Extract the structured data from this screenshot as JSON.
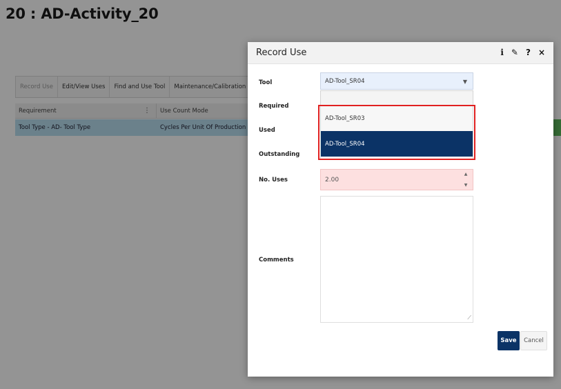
{
  "page": {
    "title": "20 : AD-Activity_20"
  },
  "toolbar": {
    "items": [
      {
        "label": "Record Use"
      },
      {
        "label": "Edit/View Uses"
      },
      {
        "label": "Find and Use Tool"
      },
      {
        "label": "Maintenance/Calibration"
      }
    ]
  },
  "grid": {
    "columns": [
      "Requirement",
      "Use Count Mode"
    ],
    "rows": [
      {
        "requirement": "Tool Type - AD- Tool Type",
        "use_count_mode": "Cycles Per Unit Of Production"
      }
    ]
  },
  "modal": {
    "title": "Record Use",
    "header_icons": [
      "info-icon",
      "pencil-icon",
      "help-icon",
      "close-icon"
    ],
    "header_glyphs": {
      "info": "i",
      "edit": "✎",
      "help": "?",
      "close": "×"
    },
    "labels": {
      "tool": "Tool",
      "required": "Required",
      "used": "Used",
      "outstanding": "Outstanding",
      "no_uses": "No. Uses",
      "comments": "Comments"
    },
    "tool_select": {
      "value": "AD-Tool_SR04",
      "options": [
        "AD-Tool_SR03",
        "AD-Tool_SR04"
      ],
      "selected_index": 1
    },
    "no_uses_value": "2.00",
    "comments_value": "",
    "buttons": {
      "save": "Save",
      "cancel": "Cancel"
    }
  },
  "colors": {
    "primary": "#0b3366",
    "row_highlight": "#b9def0",
    "error_bg": "#fde0e0",
    "highlight_border": "#e02020"
  }
}
